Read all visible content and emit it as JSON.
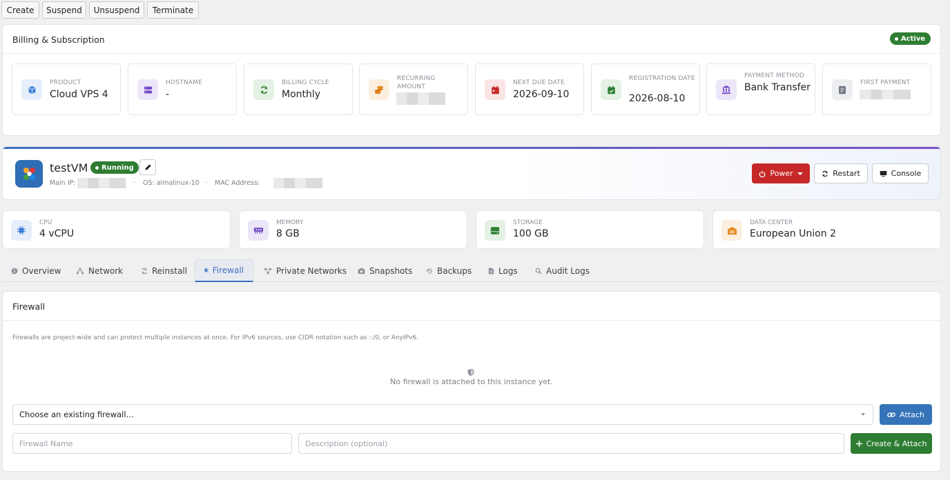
{
  "admin_actions": [
    "Create",
    "Suspend",
    "Unsuspend",
    "Terminate"
  ],
  "billing": {
    "title": "Billing & Subscription",
    "status": "Active",
    "items": [
      {
        "label": "PRODUCT",
        "value": "Cloud VPS 4",
        "icon": "cube-icon",
        "color": "#3b7dd8",
        "bg": "#e6eefb"
      },
      {
        "label": "HOSTNAME",
        "value": "-",
        "icon": "server-icon",
        "color": "#6e44c2",
        "bg": "#ece6f8"
      },
      {
        "label": "BILLING CYCLE",
        "value": "Monthly",
        "icon": "refresh-icon",
        "color": "#2e7d32",
        "bg": "#e4f2e5"
      },
      {
        "label": "RECURRING AMOUNT",
        "value": "",
        "icon": "coins-icon",
        "color": "#e08a1e",
        "bg": "#fcefe0"
      },
      {
        "label": "NEXT DUE DATE",
        "value": "2026-09-10",
        "icon": "calendar-icon",
        "color": "#c62828",
        "bg": "#fbe4e4"
      },
      {
        "label": "REGISTRATION DATE",
        "value": "2026-08-10",
        "icon": "calendar-check-icon",
        "color": "#2e7d32",
        "bg": "#e4f2e5"
      },
      {
        "label": "PAYMENT METHOD",
        "value": "Bank Transfer",
        "icon": "bank-icon",
        "color": "#6e44c2",
        "bg": "#ece6f8"
      },
      {
        "label": "FIRST PAYMENT",
        "value": "",
        "icon": "receipt-icon",
        "color": "#6b7280",
        "bg": "#eceef1"
      }
    ]
  },
  "vm": {
    "name": "testVM",
    "status": "Running",
    "main_ip_label": "Main IP:",
    "os_label": "OS: almalinux-10",
    "mac_label": "MAC Address:",
    "buttons": {
      "power": "Power",
      "restart": "Restart",
      "console": "Console"
    }
  },
  "resources": [
    {
      "label": "CPU",
      "value": "4 vCPU",
      "icon": "cpu-icon",
      "color": "#3b7dd8",
      "bg": "#e6eefb"
    },
    {
      "label": "MEMORY",
      "value": "8 GB",
      "icon": "memory-icon",
      "color": "#6e44c2",
      "bg": "#ece6f8"
    },
    {
      "label": "STORAGE",
      "value": "100 GB",
      "icon": "storage-icon",
      "color": "#2e7d32",
      "bg": "#e4f2e5"
    },
    {
      "label": "DATA CENTER",
      "value": "European Union 2",
      "icon": "warehouse-icon",
      "color": "#e08a1e",
      "bg": "#fcefe0"
    }
  ],
  "tabs": [
    {
      "label": "Overview",
      "icon": "info-icon"
    },
    {
      "label": "Network",
      "icon": "network-icon"
    },
    {
      "label": "Reinstall",
      "icon": "refresh-icon"
    },
    {
      "label": "Firewall",
      "icon": "shield-icon",
      "active": true
    },
    {
      "label": "Private Networks",
      "icon": "share-icon"
    },
    {
      "label": "Snapshots",
      "icon": "camera-icon"
    },
    {
      "label": "Backups",
      "icon": "history-icon"
    },
    {
      "label": "Logs",
      "icon": "file-icon"
    },
    {
      "label": "Audit Logs",
      "icon": "search-icon"
    }
  ],
  "firewall": {
    "title": "Firewall",
    "description": "Firewalls are project-wide and can protect multiple instances at once. For IPv6 sources, use CIDR notation such as ::/0, or AnyIPv6.",
    "empty_message": "No firewall is attached to this instance yet.",
    "select_value": "Choose an existing firewall...",
    "attach_label": "Attach",
    "name_placeholder": "Firewall Name",
    "desc_placeholder": "Description (optional)",
    "create_label": "Create & Attach"
  }
}
